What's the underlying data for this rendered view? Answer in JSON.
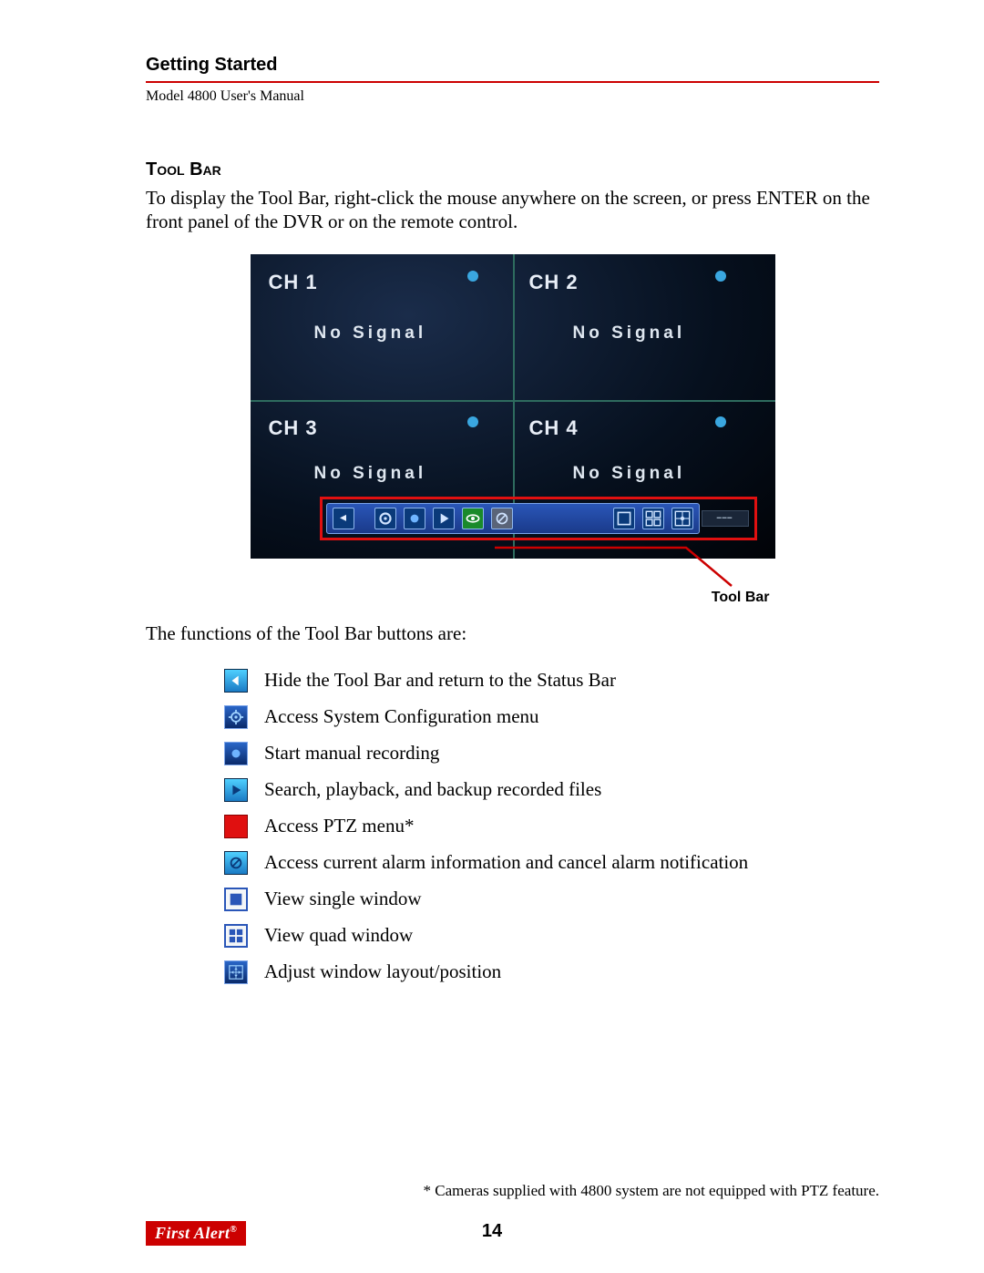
{
  "header": {
    "section": "Getting Started",
    "subtitle": "Model 4800 User's Manual"
  },
  "section": {
    "title": "Tool Bar",
    "intro": "To display the Tool Bar, right-click the mouse anywhere on the screen, or press ENTER on the front panel of the DVR or on the remote control."
  },
  "screenshot": {
    "channels": [
      {
        "label": "CH 1",
        "status": "No Signal"
      },
      {
        "label": "CH 2",
        "status": "No Signal"
      },
      {
        "label": "CH 3",
        "status": "No Signal"
      },
      {
        "label": "CH 4",
        "status": "No Signal"
      }
    ],
    "callout_label": "Tool Bar"
  },
  "functions_intro": "The functions of the Tool Bar buttons are:",
  "buttons": [
    {
      "icon": "hide",
      "desc": "Hide the Tool Bar and return to the Status Bar"
    },
    {
      "icon": "config",
      "desc": "Access System Configuration menu"
    },
    {
      "icon": "record",
      "desc": "Start manual recording"
    },
    {
      "icon": "play",
      "desc": "Search, playback, and backup recorded files"
    },
    {
      "icon": "ptz",
      "desc": "Access PTZ menu*"
    },
    {
      "icon": "alarm",
      "desc": "Access current alarm information and cancel alarm notification"
    },
    {
      "icon": "single",
      "desc": "View single window"
    },
    {
      "icon": "quad",
      "desc": "View quad window"
    },
    {
      "icon": "layout",
      "desc": "Adjust window layout/position"
    }
  ],
  "footnote": "* Cameras supplied with 4800 system are not equipped with PTZ feature.",
  "footer": {
    "page_number": "14",
    "logo_text": "First Alert"
  }
}
